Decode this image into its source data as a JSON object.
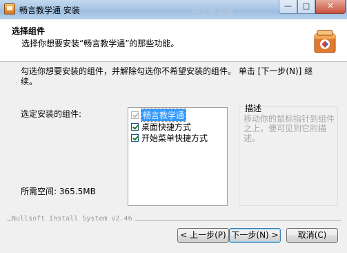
{
  "window": {
    "title": "畅言教学通 安装",
    "background_title": "畅言教学通",
    "controls": {
      "minimize": "—",
      "maximize": "□",
      "close": "✕"
    }
  },
  "header": {
    "title": "选择组件",
    "subtitle": "选择你想要安装“畅言教学通”的那些功能。",
    "logo_icon": "installer-box-icon"
  },
  "instructions": "勾选你想要安装的组件，并解除勾选你不希望安装的组件。 单击 [下一步(N)] 继续。",
  "components": {
    "label": "选定安装的组件:",
    "items": [
      {
        "label": "畅言教学通",
        "checked": true,
        "readonly": true
      },
      {
        "label": "桌面快捷方式",
        "checked": true,
        "readonly": false
      },
      {
        "label": "开始菜单快捷方式",
        "checked": true,
        "readonly": false
      }
    ]
  },
  "space_required": "所需空间: 365.5MB",
  "description": {
    "title": "描述",
    "text": "移动你的鼠标指针到组件之上，便可见到它的描述。"
  },
  "branding": "Nullsoft Install System v2.46",
  "buttons": {
    "back": "< 上一步(P)",
    "next": "下一步(N) >",
    "cancel": "取消(C)"
  }
}
